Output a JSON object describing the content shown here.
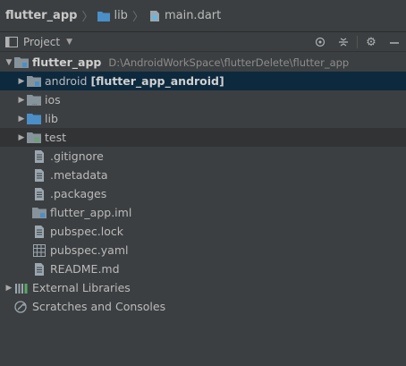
{
  "breadcrumb": {
    "project": "flutter_app",
    "folder": "lib",
    "file": "main.dart",
    "icons": [
      "folder-icon",
      "dart-file-icon"
    ]
  },
  "toolwindow": {
    "title": "Project",
    "dropdown_icon": "chevron-down-icon",
    "buttons": [
      "locate-icon",
      "collapse-all-icon",
      "gear-icon",
      "hide-icon"
    ]
  },
  "tree": {
    "root": {
      "label": "flutter_app",
      "path": "D:\\AndroidWorkSpace\\flutterDelete\\flutter_app"
    },
    "folders": [
      {
        "label": "android",
        "module": "[flutter_app_android]",
        "icon": "module-folder-icon",
        "selected": true
      },
      {
        "label": "ios",
        "icon": "folder-icon"
      },
      {
        "label": "lib",
        "icon": "source-folder-icon"
      },
      {
        "label": "test",
        "icon": "folder-icon"
      }
    ],
    "files": [
      {
        "label": ".gitignore",
        "icon": "text-file-icon"
      },
      {
        "label": ".metadata",
        "icon": "text-file-icon"
      },
      {
        "label": ".packages",
        "icon": "text-file-icon"
      },
      {
        "label": "flutter_app.iml",
        "icon": "iml-file-icon"
      },
      {
        "label": "pubspec.lock",
        "icon": "text-file-icon"
      },
      {
        "label": "pubspec.yaml",
        "icon": "yaml-file-icon"
      },
      {
        "label": "README.md",
        "icon": "markdown-file-icon"
      }
    ],
    "external_libraries": "External Libraries",
    "scratches": "Scratches and Consoles"
  },
  "colors": {
    "background": "#3c3f41",
    "selection": "#0d293e",
    "folder": "#87939a",
    "source_folder": "#4a8fc7",
    "text": "#bbbbbb"
  }
}
